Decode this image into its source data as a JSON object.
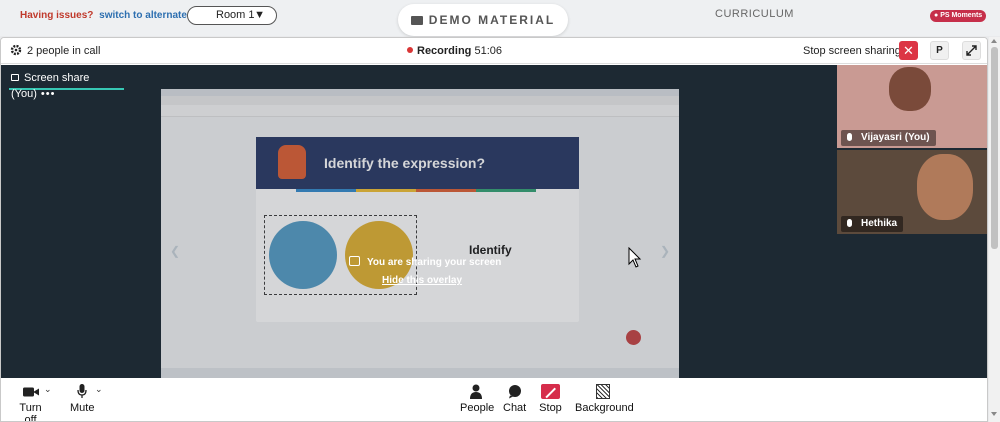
{
  "top_bar": {
    "issue_text": "Having issues?",
    "alternate_link": "switch to alternate room",
    "room_select_value": "Room 1",
    "demo_tab_label": "DEMO MATERIAL",
    "curriculum_label": "CURRICULUM",
    "moments_badge": "PS Moments"
  },
  "call_header": {
    "people_count": "2 people in call",
    "recording_label": "Recording",
    "recording_time": "51:06",
    "stop_sharing_label": "Stop screen sharing",
    "presenter_button": "P"
  },
  "stage": {
    "share_tab_label": "Screen share (You)",
    "share_tab_more": "•••",
    "overlay_message": "You are sharing your screen",
    "overlay_link": "Hide this overlay",
    "slide_title": "Identify the expression?",
    "slide_text": "Identify"
  },
  "participants": [
    {
      "name": "Vijayasri (You)"
    },
    {
      "name": "Hethika"
    }
  ],
  "toolbar": {
    "camera_label": "Turn off",
    "mic_label": "Mute",
    "people_label": "People",
    "chat_label": "Chat",
    "stop_label": "Stop",
    "background_label": "Background"
  },
  "colors": {
    "accent_red": "#dc3545",
    "tab_underline": "#37c7b4",
    "stage_bg": "#1d2933"
  }
}
